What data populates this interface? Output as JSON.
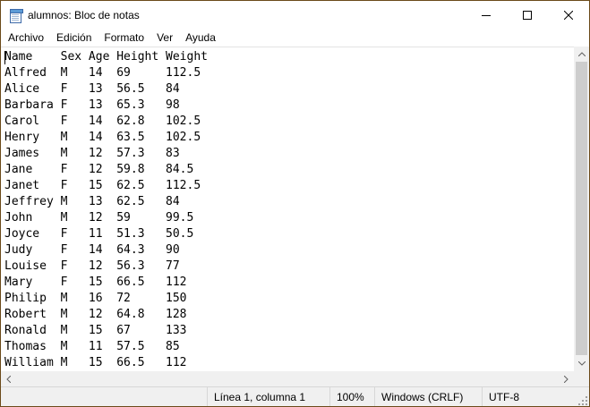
{
  "window": {
    "title": "alumnos: Bloc de notas",
    "controls": {
      "minimize": "—",
      "maximize": "☐",
      "close": "✕"
    }
  },
  "menubar": {
    "items": [
      {
        "label": "Archivo"
      },
      {
        "label": "Edición"
      },
      {
        "label": "Formato"
      },
      {
        "label": "Ver"
      },
      {
        "label": "Ayuda"
      }
    ]
  },
  "editor": {
    "lines": [
      "Name    Sex Age Height Weight",
      "Alfred  M   14  69     112.5",
      "Alice   F   13  56.5   84",
      "Barbara F   13  65.3   98",
      "Carol   F   14  62.8   102.5",
      "Henry   M   14  63.5   102.5",
      "James   M   12  57.3   83",
      "Jane    F   12  59.8   84.5",
      "Janet   F   15  62.5   112.5",
      "Jeffrey M   13  62.5   84",
      "John    M   12  59     99.5",
      "Joyce   F   11  51.3   50.5",
      "Judy    F   14  64.3   90",
      "Louise  F   12  56.3   77",
      "Mary    F   15  66.5   112",
      "Philip  M   16  72     150",
      "Robert  M   12  64.8   128",
      "Ronald  M   15  67     133",
      "Thomas  M   11  57.5   85",
      "William M   15  66.5   112"
    ]
  },
  "statusbar": {
    "position": "Línea 1, columna 1",
    "zoom": "100%",
    "line_ending": "Windows (CRLF)",
    "encoding": "UTF-8"
  },
  "colors": {
    "window_border": "#6b4a1a",
    "scrollbar_track": "#f0f0f0",
    "scrollbar_thumb": "#cdcdcd"
  }
}
